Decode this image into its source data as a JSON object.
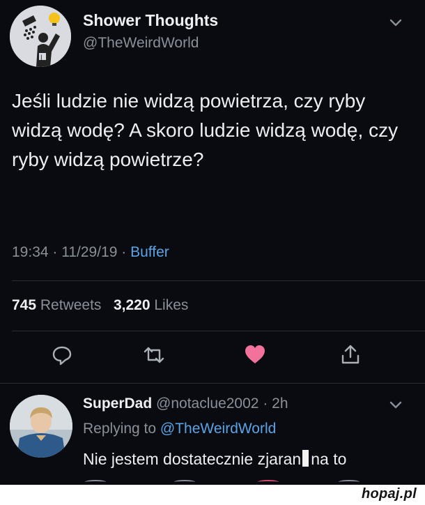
{
  "tweet": {
    "author_name": "Shower Thoughts",
    "author_handle": "@TheWeirdWorld",
    "text": "Jeśli ludzie nie widzą powietrza, czy ryby widzą wodę? A skoro ludzie widzą wodę, czy ryby widzą powietrze?",
    "time": "19:34",
    "date": "11/29/19",
    "source": "Buffer",
    "retweets_count": "745",
    "retweets_label": "Retweets",
    "likes_count": "3,220",
    "likes_label": "Likes"
  },
  "actions": {
    "icons": [
      "comment-icon",
      "retweet-icon",
      "heart-icon",
      "share-icon"
    ],
    "heart_color": "#f2729c"
  },
  "reply": {
    "author_name": "SuperDad",
    "author_handle": "@notaclue2002",
    "time": "2h",
    "replying_label": "Replying to",
    "replying_handle": "@TheWeirdWorld",
    "text_before": "Nie jestem dostatecznie zjaran",
    "text_after": "na to"
  },
  "watermark": "hopaj.pl",
  "colors": {
    "background": "#0a0b10",
    "link": "#5aa4e6",
    "muted": "#8a9099"
  }
}
